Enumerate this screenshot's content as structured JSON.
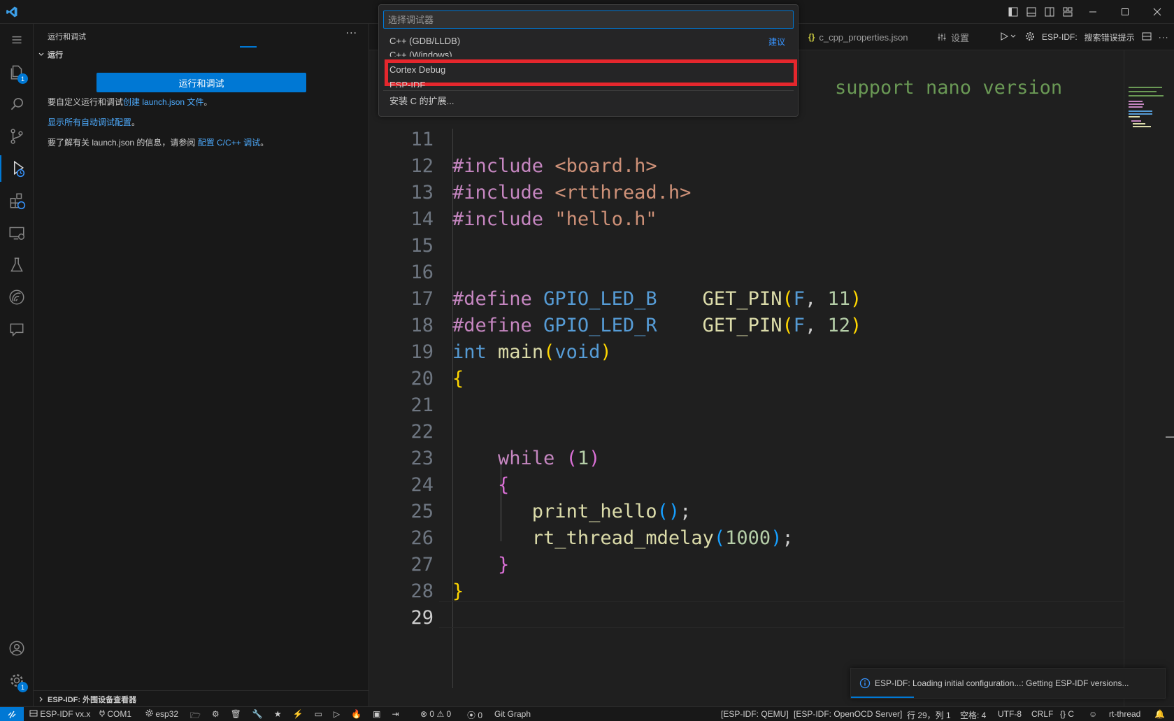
{
  "app": {
    "accent": "#0078d4"
  },
  "sidebar": {
    "title": "运行和调试",
    "section": "运行",
    "run_button": "运行和调试",
    "line1_text": "要自定义运行和调试",
    "line1_link": "创建 launch.json 文件",
    "line1_end": "。",
    "line2_link": "显示所有自动调试配置",
    "line2_end": "。",
    "line3_text": "要了解有关 launch.json 的信息，请参阅 ",
    "line3_link": "配置 C/C++ 调试",
    "line3_end": "。",
    "bottom_section": "ESP-IDF: 外围设备查看器",
    "badges": {
      "explorer": "1",
      "settings": "1"
    }
  },
  "tabs": {
    "tab1": "c_cpp_properties.json",
    "tab2": "设置",
    "toolbar_label": "ESP-IDF:",
    "toolbar_action": "搜索错误提示"
  },
  "quickpick": {
    "placeholder": "选择调试器",
    "items": [
      "C++ (GDB/LLDB)",
      "C++ (Windows)",
      "Cortex Debug",
      "ESP-IDF",
      "安装 C 的扩展..."
    ],
    "suggest_label": "建议",
    "highlight_color": "#e5272d"
  },
  "code": {
    "top_comment": "support nano version",
    "line_numbers": [
      "11",
      "12",
      "13",
      "14",
      "15",
      "16",
      "17",
      "18",
      "19",
      "20",
      "21",
      "22",
      "23",
      "24",
      "25",
      "26",
      "27",
      "28",
      "29"
    ]
  },
  "notification": {
    "text": "ESP-IDF: Loading initial configuration...: Getting ESP-IDF versions..."
  },
  "statusbar": {
    "idf": "ESP-IDF vx.x",
    "port": "COM1",
    "target": "esp32",
    "problems": "0",
    "warnings": "0",
    "ports": "0",
    "git_graph": "Git Graph",
    "qemu": "[ESP-IDF: QEMU]",
    "openocd": "[ESP-IDF: OpenOCD Server]",
    "cursor": "行 29，列 1",
    "spaces": "空格: 4",
    "encoding": "UTF-8",
    "eol": "CRLF",
    "language": "C",
    "project": "rt-thread"
  }
}
